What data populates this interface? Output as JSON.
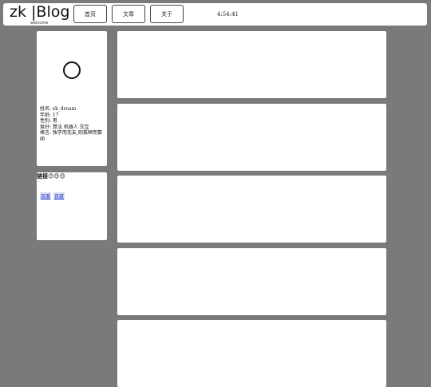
{
  "header": {
    "logo": "zk |Blog",
    "subtitle": "welcome",
    "nav": [
      {
        "label": "首页"
      },
      {
        "label": "文章"
      },
      {
        "label": "关于"
      }
    ],
    "clock": "4:54:41"
  },
  "profile": {
    "avatar_icon": "circle-avatar-icon",
    "lines": [
      "姓名: zk_dream",
      "年龄: 17",
      "性别: 男",
      "爱好: 算法 机器人 交互",
      "格言: 独学而无友,则孤陋而寡闻"
    ]
  },
  "links": {
    "title": "链接😊😊😊",
    "items": [
      {
        "label": "百度"
      },
      {
        "label": "百度"
      }
    ]
  },
  "posts": [
    {},
    {},
    {},
    {},
    {}
  ]
}
